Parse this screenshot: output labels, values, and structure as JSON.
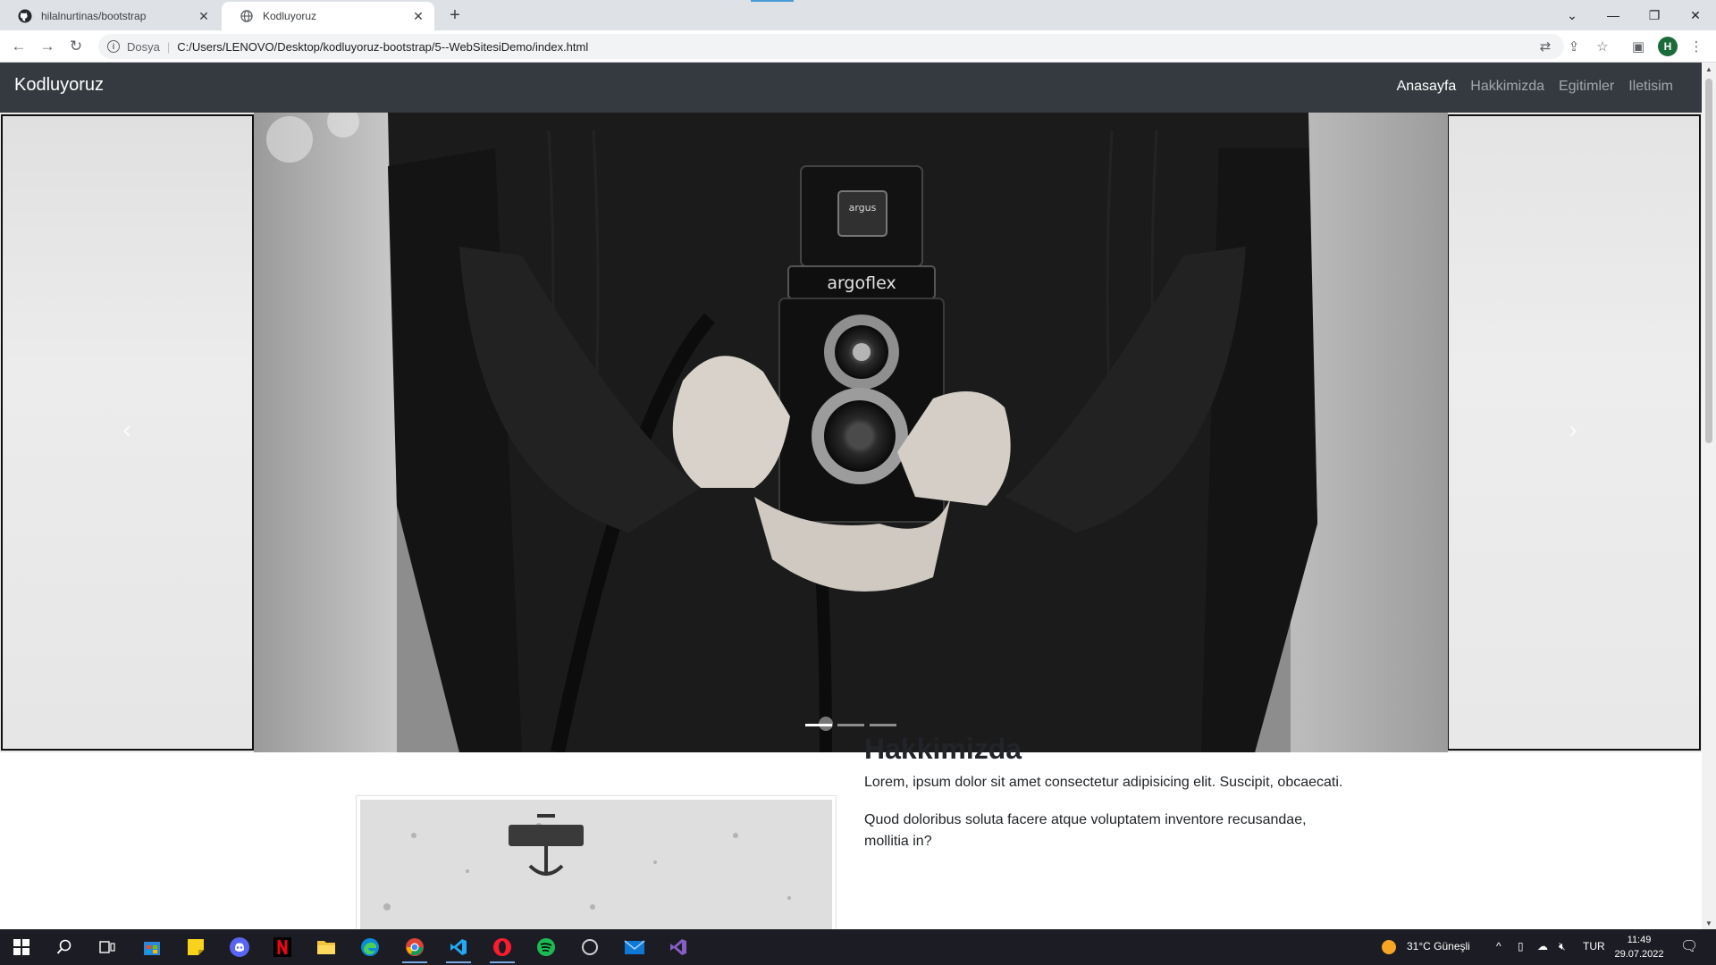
{
  "browser": {
    "tabs": [
      {
        "title": "hilalnurtinas/bootstrap",
        "icon": "github-icon"
      },
      {
        "title": "Kodluyoruz",
        "icon": "globe-icon"
      }
    ],
    "omnibox": {
      "scheme_label": "Dosya",
      "url": "C:/Users/LENOVO/Desktop/kodluyoruz-bootstrap/5--WebSitesiDemo/index.html"
    },
    "profile_initial": "H"
  },
  "site": {
    "brand": "Kodluyoruz",
    "nav": [
      "Anasayfa",
      "Hakkimizda",
      "Egitimler",
      "Iletisim"
    ],
    "active_nav": "Anasayfa",
    "carousel": {
      "slide_count": 3,
      "active_slide": 1,
      "camera_brand": "argoflex",
      "camera_badge": "argus"
    },
    "about": {
      "title": "Hakkimizda",
      "p1": "Lorem, ipsum dolor sit amet consectetur adipisicing elit. Suscipit, obcaecati.",
      "p2": "Quod doloribus soluta facere atque voluptatem inventore recusandae, mollitia in?"
    }
  },
  "taskbar": {
    "weather": "31°C  Güneşli",
    "language": "TUR",
    "time": "11:49",
    "date": "29.07.2022"
  },
  "colors": {
    "navbar": "#343a40",
    "tab_bar": "#dee1e6",
    "taskbar": "#1c1c24",
    "profile": "#1b6b3a"
  }
}
